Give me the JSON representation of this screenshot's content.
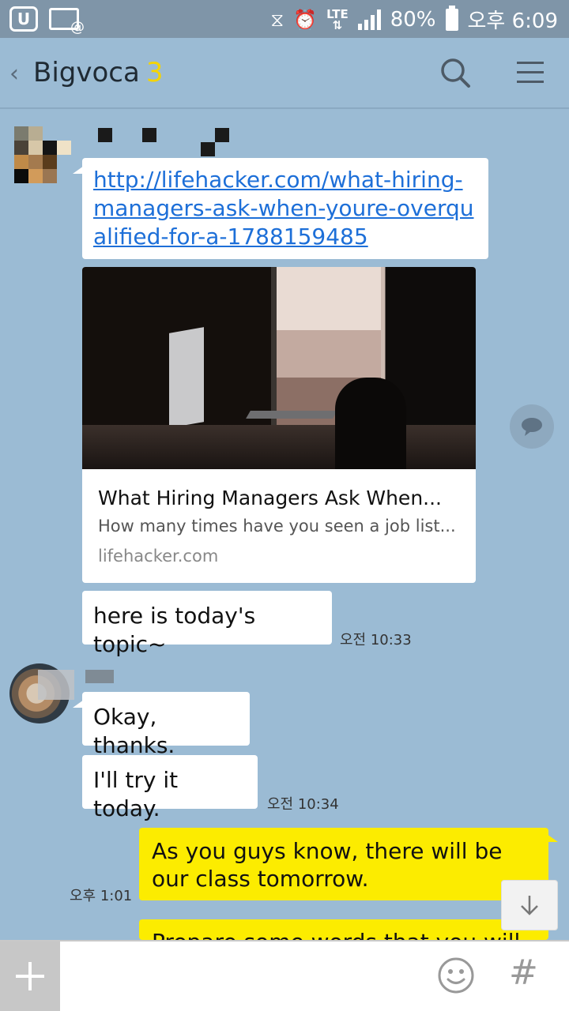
{
  "status_bar": {
    "battery": "80%",
    "network": "LTE",
    "time": "오후 6:09"
  },
  "header": {
    "title": "Bigvoca",
    "member_count": "3",
    "back_icon": "chevron-left-icon",
    "search_icon": "search-icon",
    "menu_icon": "hamburger-menu-icon"
  },
  "messages": {
    "link_url": "http://lifehacker.com/what-hiring-managers-ask-when-youre-overqualified-for-a-1788159485",
    "preview": {
      "title": "What Hiring Managers Ask When...",
      "description": "How many times have you seen a job list...",
      "domain": "lifehacker.com"
    },
    "topic_text": "here is today's topic~",
    "topic_time": "오전 10:33",
    "reply1": "Okay, thanks.",
    "reply2": "I'll try it today.",
    "reply_time": "오전 10:34",
    "mine1": "As you guys know, there will be our class tomorrow.",
    "mine1_time": "오후 1:01",
    "mine2_partial": "Prepare some words that you will"
  },
  "input_bar": {
    "placeholder": "",
    "plus_icon": "plus-icon",
    "emoji_icon": "emoji-icon",
    "hash_label": "#"
  },
  "colors": {
    "chat_background": "#9bbbd4",
    "my_bubble": "#fcec00",
    "other_bubble": "#ffffff",
    "member_count": "#f5d400"
  }
}
